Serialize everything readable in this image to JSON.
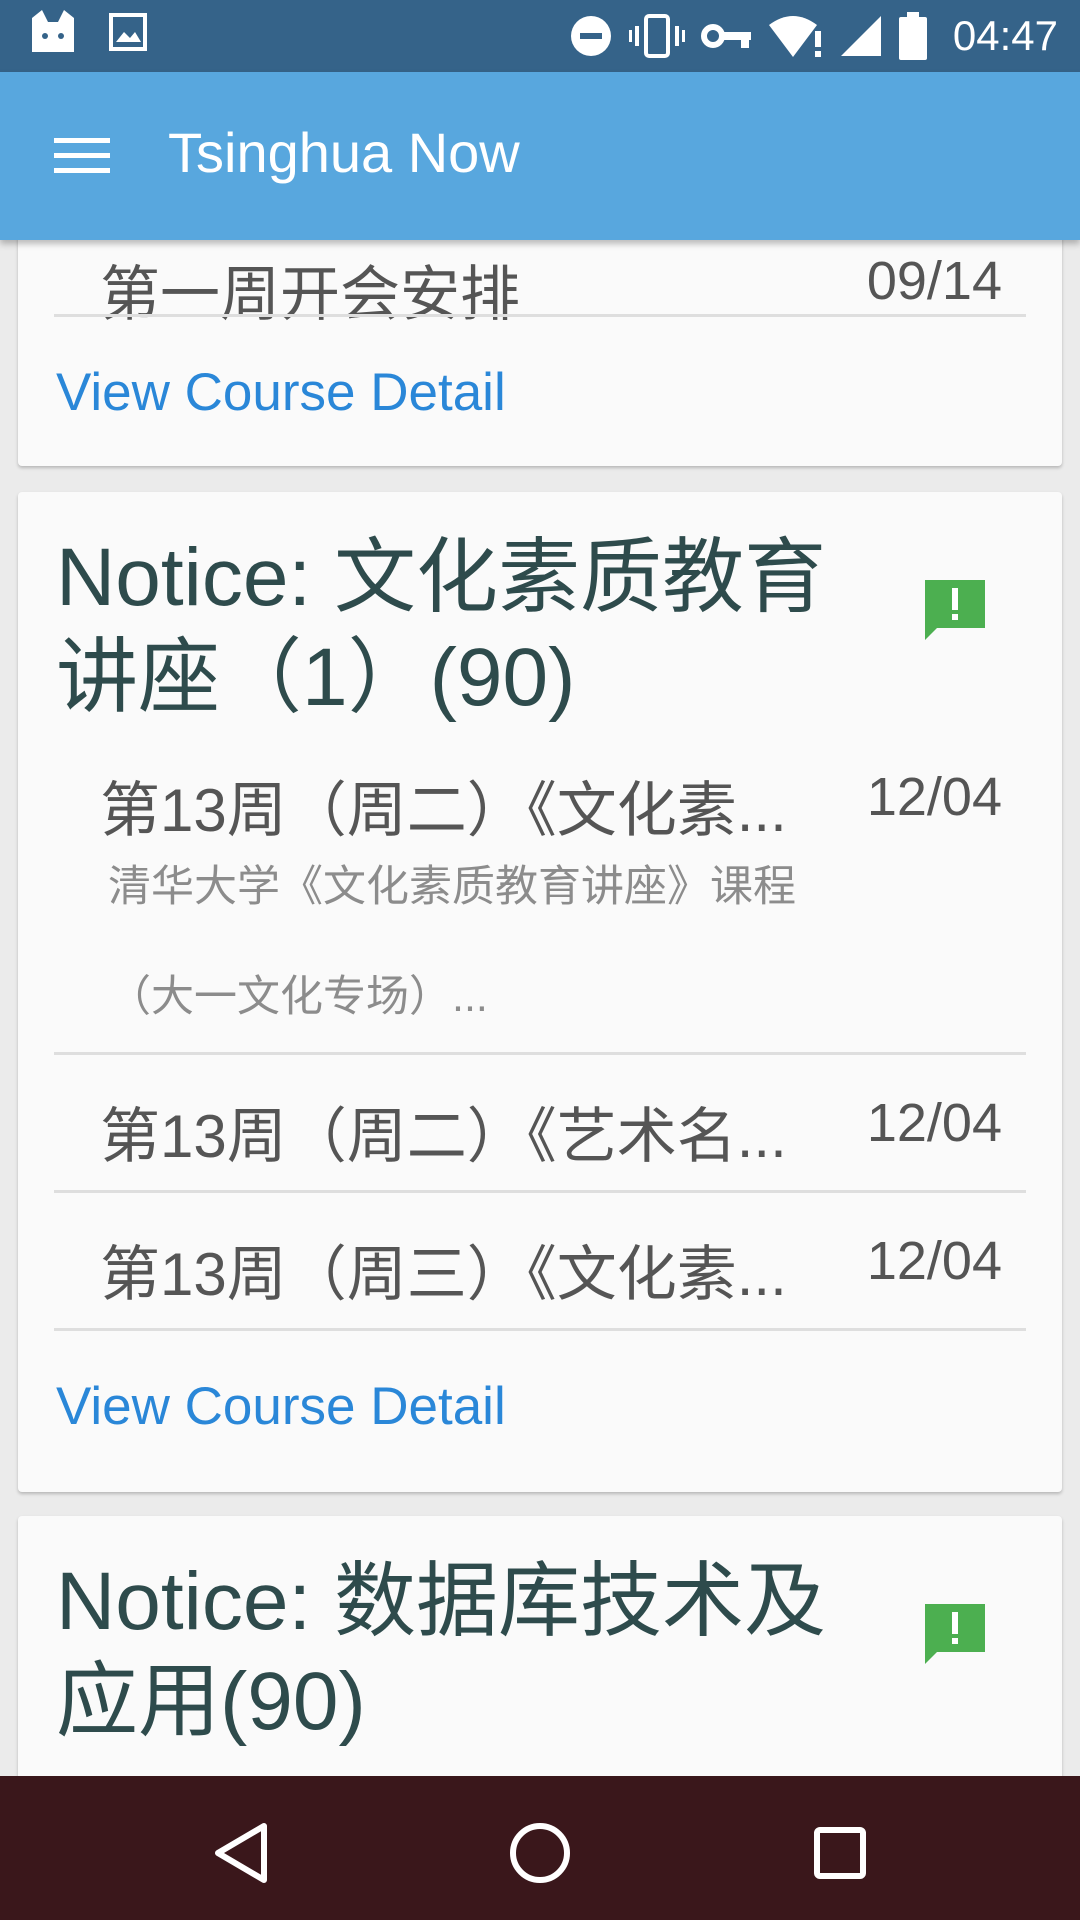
{
  "status_bar": {
    "time": "04:47",
    "icons": [
      "cat-app-icon",
      "image-icon",
      "do-not-disturb-icon",
      "vibrate-icon",
      "vpn-key-icon",
      "wifi-alert-icon",
      "cell-signal-icon",
      "battery-icon"
    ]
  },
  "app_bar": {
    "title": "Tsinghua Now",
    "menu_icon": "hamburger-menu-icon"
  },
  "cards": [
    {
      "rows": [
        {
          "title": "第一周开会安排",
          "date": "09/14"
        }
      ],
      "link": "View Course Detail"
    },
    {
      "title": "Notice: 文化素质教育讲座（1）(90)",
      "title_line1": "Notice: 文化素质教育",
      "title_line2": "讲座（1）(90)",
      "icon": "feedback-alert-icon",
      "rows": [
        {
          "title": "第13周（周二）《文化素...",
          "date": "12/04",
          "subtitle_line1": "清华大学《文化素质教育讲座》课程",
          "subtitle_line2": "（大一文化专场）..."
        },
        {
          "title": "第13周（周二）《艺术名...",
          "date": "12/04"
        },
        {
          "title": "第13周（周三）《文化素...",
          "date": "12/04"
        }
      ],
      "link": "View Course Detail"
    },
    {
      "title_line1": "Notice: 数据库技术及",
      "title_line2": "应用(90)",
      "icon": "feedback-alert-icon"
    }
  ],
  "colors": {
    "status_bar": "#356389",
    "app_bar": "#58a7de",
    "nav_bar": "#3a171b",
    "link": "#2a87d8",
    "notice_icon": "#4caf50",
    "card_title": "#2e4b4c"
  },
  "nav_bar": {
    "buttons": [
      "back-icon",
      "home-icon",
      "recents-icon"
    ]
  }
}
